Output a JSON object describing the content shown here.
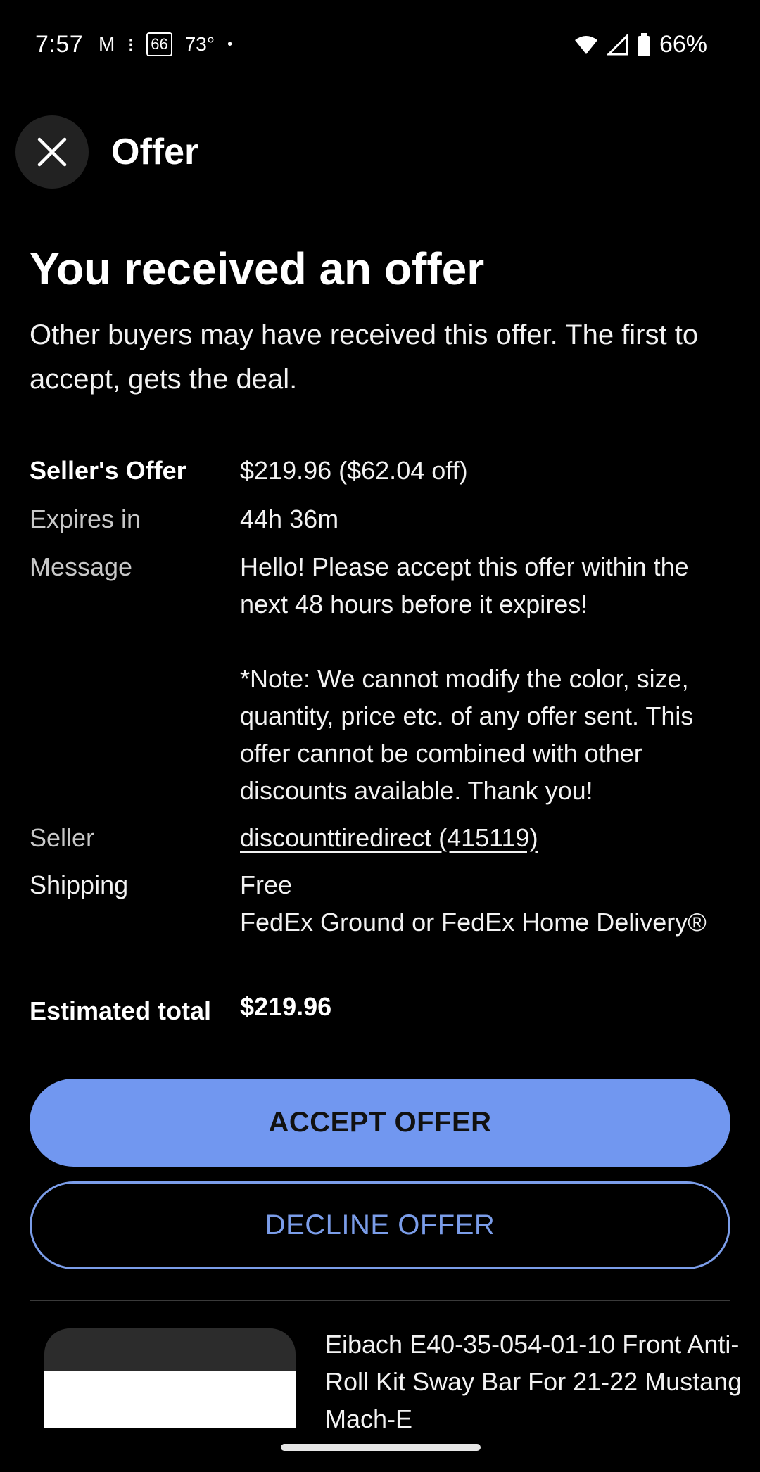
{
  "status_bar": {
    "time": "7:57",
    "gmail_icon": "M",
    "app_icon": "⁝",
    "badge": "66",
    "temperature": "73°",
    "dot": "•",
    "battery": "66%"
  },
  "header": {
    "title": "Offer"
  },
  "offer": {
    "title": "You received an offer",
    "subtitle": "Other buyers may have received this offer. The first to accept, gets the deal."
  },
  "details": {
    "sellers_offer_label": "Seller's Offer",
    "sellers_offer_value": "$219.96 ($62.04 off)",
    "expires_label": "Expires in",
    "expires_value": "44h 36m",
    "message_label": "Message",
    "message_line1": "Hello! Please accept this offer within the next 48 hours before it expires!",
    "message_line2": "*Note: We cannot modify the color, size, quantity, price etc. of any offer sent. This offer cannot be combined with other discounts available. Thank you!",
    "seller_label": "Seller",
    "seller_value": "discounttiredirect (415119)",
    "shipping_label": "Shipping",
    "shipping_value": "Free",
    "shipping_method": "FedEx Ground or FedEx Home Delivery®",
    "total_label": "Estimated total",
    "total_value": "$219.96"
  },
  "buttons": {
    "accept": "ACCEPT OFFER",
    "decline": "DECLINE OFFER"
  },
  "product": {
    "title": "Eibach E40-35-054-01-10 Front Anti-Roll Kit Sway Bar For 21-22 Mustang Mach-E"
  },
  "colors": {
    "accent": "#7197f0",
    "background": "#000000"
  }
}
